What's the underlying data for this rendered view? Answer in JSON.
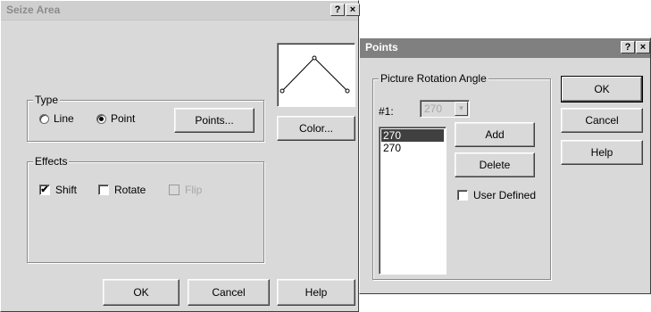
{
  "seize_area": {
    "title": "Seize Area",
    "help_btn": "?",
    "close_btn": "×",
    "type_group": {
      "legend": "Type",
      "line_label": "Line",
      "point_label": "Point",
      "selected": "Point",
      "points_button": "Points..."
    },
    "color_button": "Color...",
    "effects_group": {
      "legend": "Effects",
      "shift_label": "Shift",
      "shift_checked": true,
      "rotate_label": "Rotate",
      "rotate_checked": false,
      "flip_label": "Flip",
      "flip_disabled": true
    },
    "buttons": {
      "ok": "OK",
      "cancel": "Cancel",
      "help": "Help"
    }
  },
  "points": {
    "title": "Points",
    "help_btn": "?",
    "close_btn": "×",
    "group_legend": "Picture Rotation Angle",
    "index_label": "#1:",
    "angle_value": "270",
    "list_items": [
      "270",
      "270"
    ],
    "selected_index": 0,
    "add_button": "Add",
    "delete_button": "Delete",
    "user_defined_label": "User Defined",
    "user_defined_checked": false,
    "buttons": {
      "ok": "OK",
      "cancel": "Cancel",
      "help": "Help"
    }
  }
}
